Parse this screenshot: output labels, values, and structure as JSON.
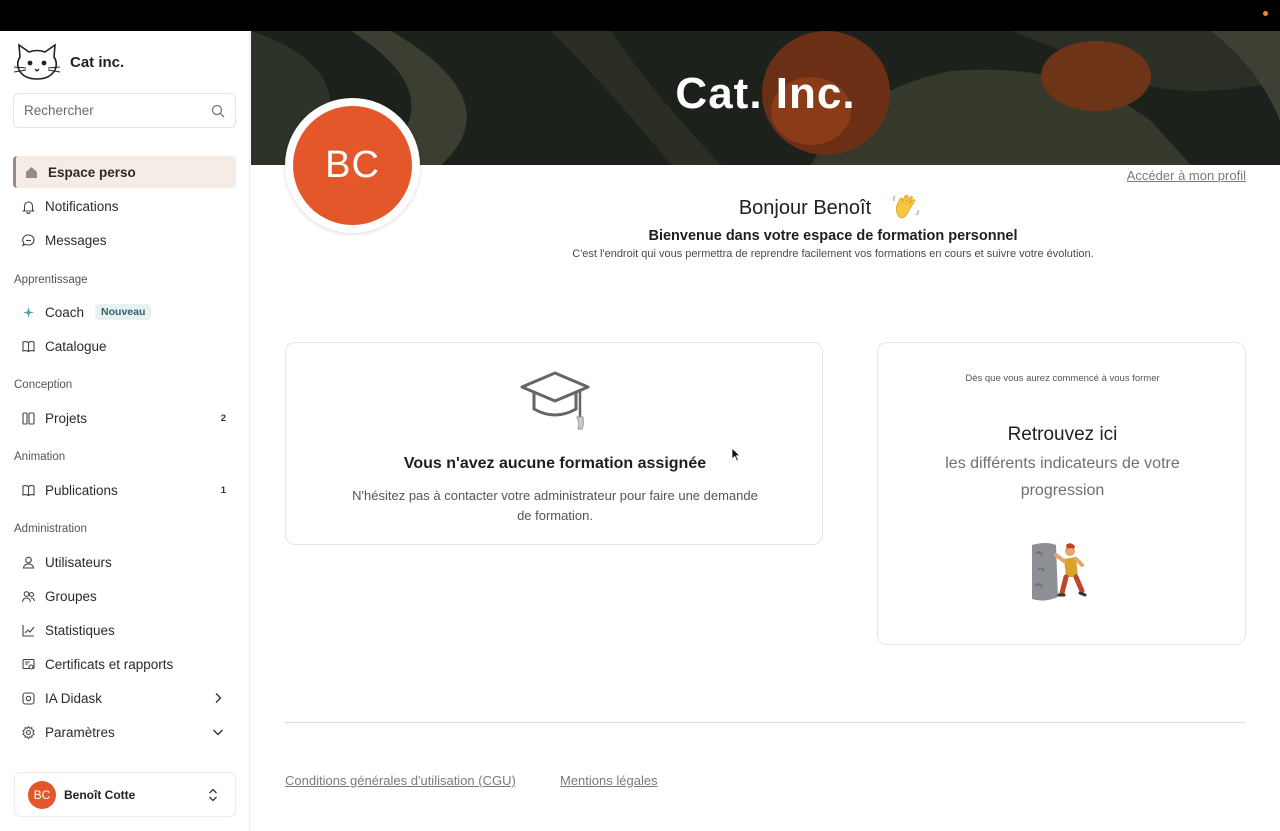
{
  "brand": {
    "name": "Cat inc."
  },
  "search": {
    "placeholder": "Rechercher"
  },
  "sidebar": {
    "top_items": [
      {
        "label": "Espace perso",
        "icon": "home-icon",
        "active": true
      },
      {
        "label": "Notifications",
        "icon": "bell-icon"
      },
      {
        "label": "Messages",
        "icon": "message-icon"
      }
    ],
    "sections": {
      "apprentissage": "Apprentissage",
      "conception": "Conception",
      "animation": "Animation",
      "administration": "Administration"
    },
    "coach": {
      "label": "Coach",
      "badge": "Nouveau",
      "icon": "sparkle-icon"
    },
    "catalogue": {
      "label": "Catalogue",
      "icon": "book-icon"
    },
    "projets": {
      "label": "Projets",
      "count": "2",
      "icon": "columns-icon"
    },
    "publications": {
      "label": "Publications",
      "count": "1",
      "icon": "book-open-icon"
    },
    "admin_items": [
      {
        "label": "Utilisateurs",
        "icon": "user-icon"
      },
      {
        "label": "Groupes",
        "icon": "users-icon"
      },
      {
        "label": "Statistiques",
        "icon": "chart-icon"
      },
      {
        "label": "Certificats et rapports",
        "icon": "certificate-icon"
      },
      {
        "label": "IA Didask",
        "icon": "ai-icon"
      },
      {
        "label": "Paramètres",
        "icon": "gear-icon"
      }
    ]
  },
  "user": {
    "initials": "BC",
    "name": "Benoît Cotte"
  },
  "banner": {
    "title": "Cat. Inc."
  },
  "profile": {
    "initials": "BC",
    "link": "Accéder à mon profil"
  },
  "greeting": {
    "hello": "Bonjour Benoît",
    "welcome": "Bienvenue dans votre espace de formation personnel",
    "sub": "C'est l'endroit qui vous permettra de reprendre facilement vos formations en cours et suivre votre évolution."
  },
  "empty_card": {
    "title": "Vous n'avez aucune formation assignée",
    "desc": "N'hésitez pas à contacter votre administrateur pour faire une demande de formation."
  },
  "progress_card": {
    "small": "Dès que vous aurez commencé à vous former",
    "title": "Retrouvez ici",
    "desc": "les différents indicateurs de votre progression"
  },
  "footer": {
    "cgu": "Conditions générales d'utilisation (CGU)",
    "legal": "Mentions légales"
  },
  "colors": {
    "accent": "#e3572b",
    "active_bg": "#f6ece6"
  }
}
